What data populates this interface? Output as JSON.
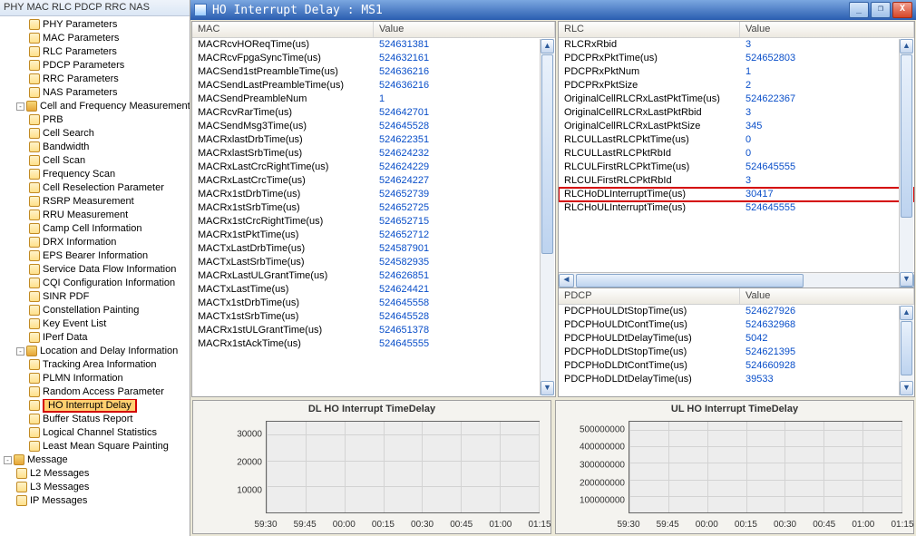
{
  "tree": {
    "header": "PHY MAC RLC PDCP RRC NAS",
    "groups": [
      {
        "kind": "leaf",
        "indent": 2,
        "label": "PHY Parameters"
      },
      {
        "kind": "leaf",
        "indent": 2,
        "label": "MAC Parameters"
      },
      {
        "kind": "leaf",
        "indent": 2,
        "label": "RLC Parameters"
      },
      {
        "kind": "leaf",
        "indent": 2,
        "label": "PDCP Parameters"
      },
      {
        "kind": "leaf",
        "indent": 2,
        "label": "RRC Parameters"
      },
      {
        "kind": "leaf",
        "indent": 2,
        "label": "NAS Parameters"
      },
      {
        "kind": "parent",
        "indent": 1,
        "label": "Cell and Frequency Measurement"
      },
      {
        "kind": "leaf",
        "indent": 2,
        "label": "PRB"
      },
      {
        "kind": "leaf",
        "indent": 2,
        "label": "Cell Search"
      },
      {
        "kind": "leaf",
        "indent": 2,
        "label": "Bandwidth"
      },
      {
        "kind": "leaf",
        "indent": 2,
        "label": "Cell Scan"
      },
      {
        "kind": "leaf",
        "indent": 2,
        "label": "Frequency Scan"
      },
      {
        "kind": "leaf",
        "indent": 2,
        "label": "Cell Reselection Parameter"
      },
      {
        "kind": "leaf",
        "indent": 2,
        "label": "RSRP Measurement"
      },
      {
        "kind": "leaf",
        "indent": 2,
        "label": "RRU Measurement"
      },
      {
        "kind": "leaf",
        "indent": 2,
        "label": "Camp Cell Information"
      },
      {
        "kind": "leaf",
        "indent": 2,
        "label": "DRX Information"
      },
      {
        "kind": "leaf",
        "indent": 2,
        "label": "EPS Bearer Information"
      },
      {
        "kind": "leaf",
        "indent": 2,
        "label": "Service Data Flow Information"
      },
      {
        "kind": "leaf",
        "indent": 2,
        "label": "CQI Configuration Information"
      },
      {
        "kind": "leaf",
        "indent": 2,
        "label": "SINR PDF"
      },
      {
        "kind": "leaf",
        "indent": 2,
        "label": "Constellation Painting"
      },
      {
        "kind": "leaf",
        "indent": 2,
        "label": "Key Event List"
      },
      {
        "kind": "leaf",
        "indent": 2,
        "label": "IPerf Data"
      },
      {
        "kind": "parent",
        "indent": 1,
        "label": "Location and Delay Information"
      },
      {
        "kind": "leaf",
        "indent": 2,
        "label": "Tracking Area Information"
      },
      {
        "kind": "leaf",
        "indent": 2,
        "label": "PLMN Information"
      },
      {
        "kind": "leaf",
        "indent": 2,
        "label": "Random Access Parameter"
      },
      {
        "kind": "leaf",
        "indent": 2,
        "label": "HO Interrupt Delay",
        "highlight": true,
        "sel": true
      },
      {
        "kind": "leaf",
        "indent": 2,
        "label": "Buffer Status Report"
      },
      {
        "kind": "leaf",
        "indent": 2,
        "label": "Logical Channel Statistics"
      },
      {
        "kind": "leaf",
        "indent": 2,
        "label": "Least Mean Square Painting"
      },
      {
        "kind": "parent",
        "indent": 0,
        "label": "Message"
      },
      {
        "kind": "leaf",
        "indent": 1,
        "label": "L2 Messages"
      },
      {
        "kind": "leaf",
        "indent": 1,
        "label": "L3 Messages"
      },
      {
        "kind": "leaf",
        "indent": 1,
        "label": "IP Messages"
      }
    ]
  },
  "window": {
    "title": "HO Interrupt Delay : MS1"
  },
  "headers": {
    "name_mac": "MAC",
    "name_rlc": "RLC",
    "name_pdcp": "PDCP",
    "value": "Value"
  },
  "mac_rows": [
    {
      "name": "MACRcvHOReqTime(us)",
      "val": "524631381"
    },
    {
      "name": "MACRcvFpgaSyncTime(us)",
      "val": "524632161"
    },
    {
      "name": "MACSend1stPreambleTime(us)",
      "val": "524636216"
    },
    {
      "name": "MACSendLastPreambleTime(us)",
      "val": "524636216"
    },
    {
      "name": "MACSendPreambleNum",
      "val": "1"
    },
    {
      "name": "MACRcvRarTime(us)",
      "val": "524642701"
    },
    {
      "name": "MACSendMsg3Time(us)",
      "val": "524645528"
    },
    {
      "name": "MACRxlastDrbTime(us)",
      "val": "524622351"
    },
    {
      "name": "MACRxlastSrbTime(us)",
      "val": "524624232"
    },
    {
      "name": "MACRxLastCrcRightTime(us)",
      "val": "524624229"
    },
    {
      "name": "MACRxLastCrcTime(us)",
      "val": "524624227"
    },
    {
      "name": "MACRx1stDrbTime(us)",
      "val": "524652739"
    },
    {
      "name": "MACRx1stSrbTime(us)",
      "val": "524652725"
    },
    {
      "name": "MACRx1stCrcRightTime(us)",
      "val": "524652715"
    },
    {
      "name": "MACRx1stPktTime(us)",
      "val": "524652712"
    },
    {
      "name": "MACTxLastDrbTime(us)",
      "val": "524587901"
    },
    {
      "name": "MACTxLastSrbTime(us)",
      "val": "524582935"
    },
    {
      "name": "MACRxLastULGrantTime(us)",
      "val": "524626851"
    },
    {
      "name": "MACTxLastTime(us)",
      "val": "524624421"
    },
    {
      "name": "MACTx1stDrbTime(us)",
      "val": "524645558"
    },
    {
      "name": "MACTx1stSrbTime(us)",
      "val": "524645528"
    },
    {
      "name": "MACRx1stULGrantTime(us)",
      "val": "524651378"
    },
    {
      "name": "MACRx1stAckTime(us)",
      "val": "524645555"
    }
  ],
  "rlc_rows": [
    {
      "name": "RLCRxRbid",
      "val": "3"
    },
    {
      "name": "PDCPRxPktTime(us)",
      "val": "524652803"
    },
    {
      "name": "PDCPRxPktNum",
      "val": "1"
    },
    {
      "name": "PDCPRxPktSize",
      "val": "2"
    },
    {
      "name": "OriginalCellRLCRxLastPktTime(us)",
      "val": "524622367"
    },
    {
      "name": "OriginalCellRLCRxLastPktRbid",
      "val": "3"
    },
    {
      "name": "OriginalCellRLCRxLastPktSize",
      "val": "345"
    },
    {
      "name": "RLCULLastRLCPktTime(us)",
      "val": "0"
    },
    {
      "name": "RLCULLastRLCPktRbId",
      "val": "0"
    },
    {
      "name": "RLCULFirstRLCPktTime(us)",
      "val": "524645555"
    },
    {
      "name": "RLCULFirstRLCPktRbId",
      "val": "3"
    },
    {
      "name": "RLCHoDLInterruptTime(us)",
      "val": "30417",
      "highlight": true
    },
    {
      "name": "RLCHoULInterruptTime(us)",
      "val": "524645555"
    }
  ],
  "pdcp_rows": [
    {
      "name": "PDCPHoULDtStopTime(us)",
      "val": "524627926"
    },
    {
      "name": "PDCPHoULDtContTime(us)",
      "val": "524632968"
    },
    {
      "name": "PDCPHoULDtDelayTime(us)",
      "val": "5042"
    },
    {
      "name": "PDCPHoDLDtStopTime(us)",
      "val": "524621395"
    },
    {
      "name": "PDCPHoDLDtContTime(us)",
      "val": "524660928"
    },
    {
      "name": "PDCPHoDLDtDelayTime(us)",
      "val": "39533"
    }
  ],
  "chart_data": [
    {
      "type": "line",
      "title": "DL HO Interrupt TimeDelay",
      "yticks": [
        10000,
        20000,
        30000
      ],
      "xticks": [
        "59:30",
        "59:45",
        "00:00",
        "00:15",
        "00:30",
        "00:45",
        "01:00",
        "01:15"
      ],
      "ylim": [
        0,
        35000
      ],
      "series": [
        {
          "name": "DL",
          "values": []
        }
      ]
    },
    {
      "type": "line",
      "title": "UL HO Interrupt TimeDelay",
      "yticks": [
        100000000,
        200000000,
        300000000,
        400000000,
        500000000
      ],
      "xticks": [
        "59:30",
        "59:45",
        "00:00",
        "00:15",
        "00:30",
        "00:45",
        "01:00",
        "01:15"
      ],
      "ylim": [
        0,
        550000000
      ],
      "series": [
        {
          "name": "UL",
          "values": []
        }
      ]
    }
  ]
}
